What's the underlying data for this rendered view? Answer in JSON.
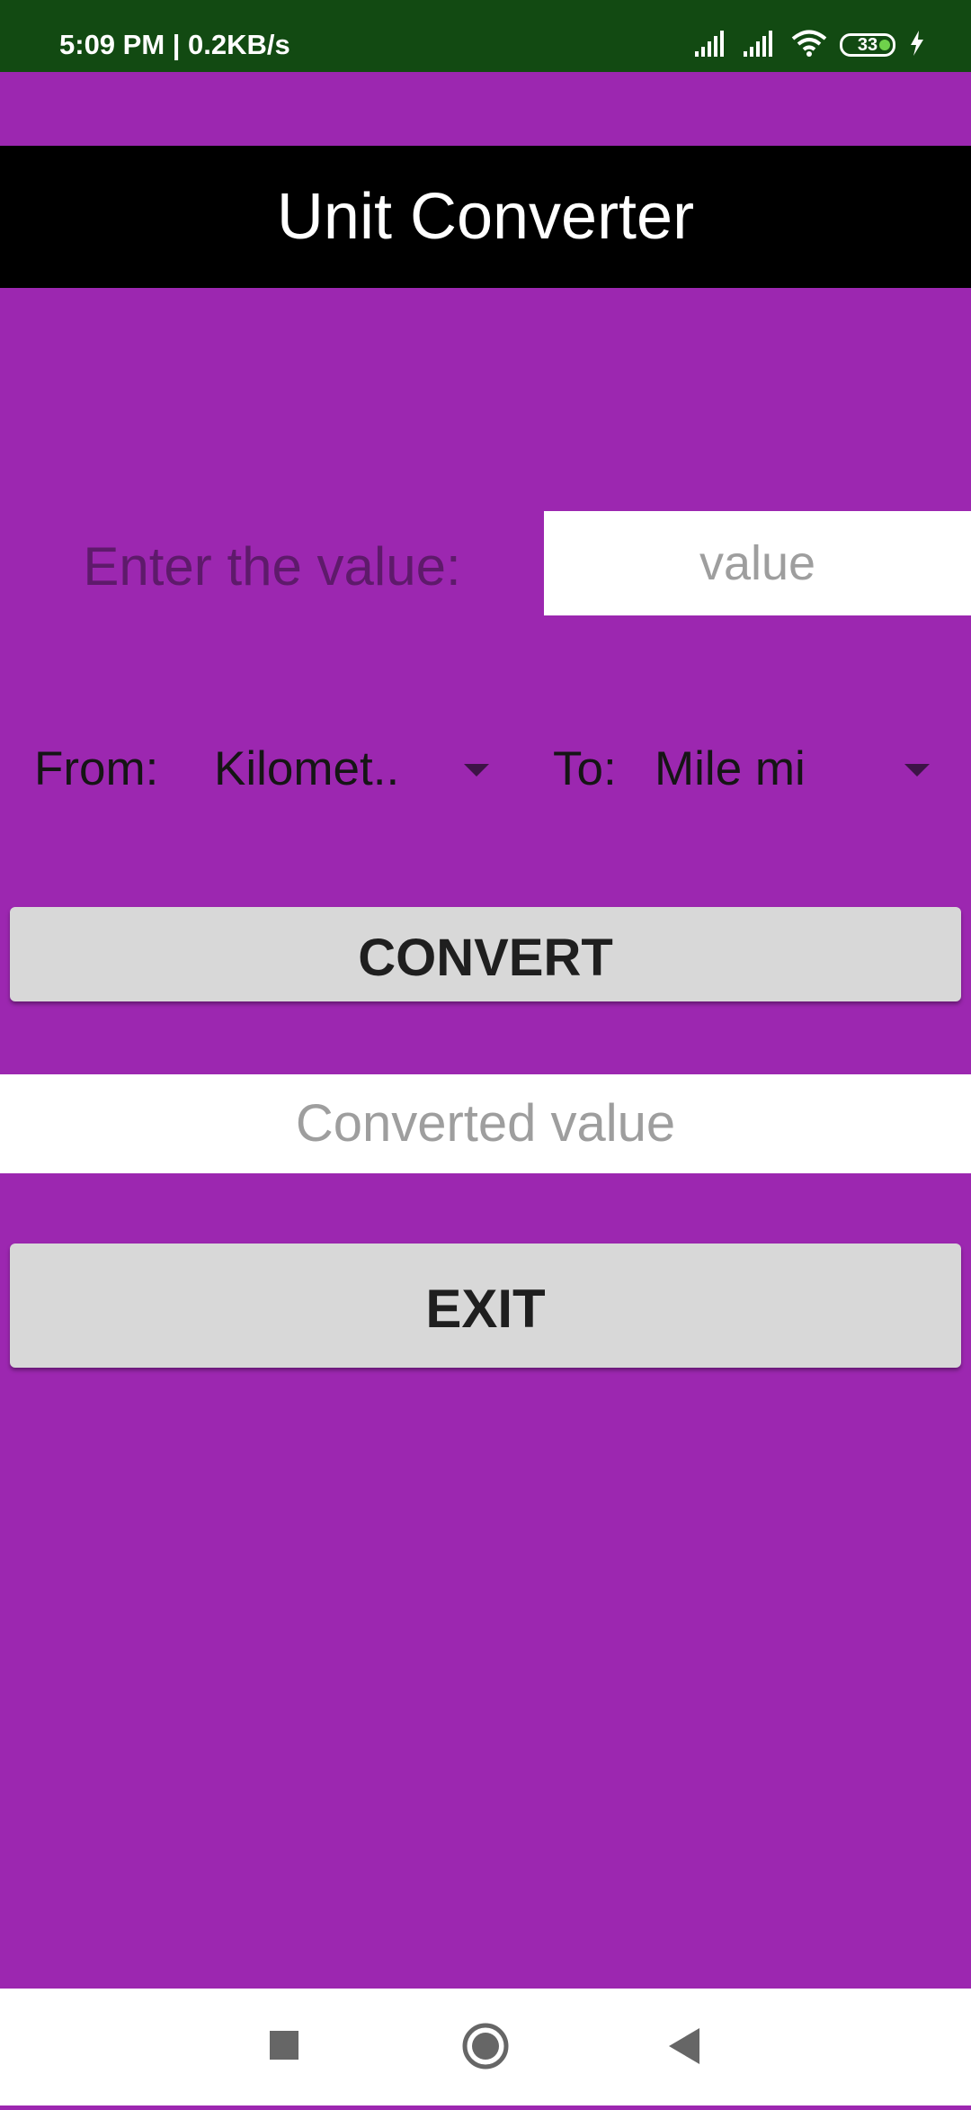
{
  "status_bar": {
    "time_text": "5:09 PM | 0.2KB/s",
    "battery_level": "33",
    "icons": [
      "signal-icon",
      "signal-icon",
      "wifi-icon",
      "battery-icon",
      "charging-icon"
    ]
  },
  "app": {
    "title": "Unit Converter"
  },
  "form": {
    "enter_label": "Enter the value:",
    "value_placeholder": "value",
    "value": "",
    "from_label": "From:",
    "from_selected": "Kilomet..",
    "to_label": "To:",
    "to_selected": "Mile mi",
    "convert_label": "CONVERT",
    "result_placeholder": "Converted value",
    "exit_label": "EXIT"
  },
  "nav_bar": {
    "buttons": [
      "recents-icon",
      "home-icon",
      "back-icon"
    ]
  },
  "colors": {
    "background": "#9c27b0",
    "status_bar": "#124a12",
    "app_bar": "#000000",
    "button": "#d8d8d8"
  }
}
